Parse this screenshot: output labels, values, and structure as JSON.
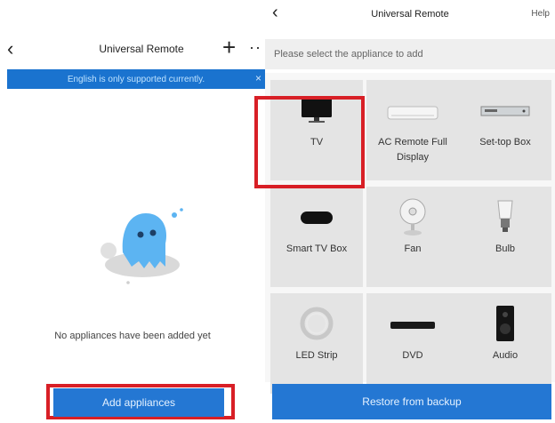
{
  "left": {
    "back_icon": "chevron-left-icon",
    "title": "Universal Remote",
    "add_icon": "plus-icon",
    "more_icon": "more-icon",
    "banner_text": "English is only supported currently.",
    "banner_close": "×",
    "empty_text": "No appliances have been added yet",
    "add_button": "Add appliances"
  },
  "right": {
    "back_icon": "chevron-left-icon",
    "title": "Universal Remote",
    "help": "Help",
    "prompt": "Please select the appliance to add",
    "tiles": [
      {
        "label": "TV",
        "icon": "tv-icon"
      },
      {
        "label": "AC Remote Full Display",
        "icon": "ac-icon"
      },
      {
        "label": "Set-top Box",
        "icon": "settop-box-icon"
      },
      {
        "label": "Smart TV Box",
        "icon": "smart-tv-box-icon"
      },
      {
        "label": "Fan",
        "icon": "fan-icon"
      },
      {
        "label": "Bulb",
        "icon": "bulb-icon"
      },
      {
        "label": "LED Strip",
        "icon": "led-strip-icon"
      },
      {
        "label": "DVD",
        "icon": "dvd-icon"
      },
      {
        "label": "Audio",
        "icon": "audio-icon"
      }
    ],
    "restore_button": "Restore from backup"
  },
  "colors": {
    "accent": "#2477d3",
    "banner": "#1a73cf",
    "highlight": "#d81f26"
  }
}
